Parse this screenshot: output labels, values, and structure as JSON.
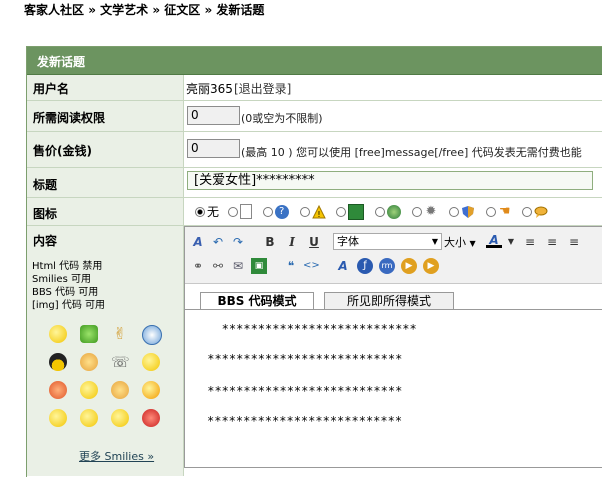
{
  "breadcrumb": {
    "items": [
      "客家人社区",
      "文学艺术",
      "征文区",
      "发新话题"
    ],
    "sep": " » "
  },
  "panel": {
    "title": "发新话题"
  },
  "form": {
    "username": {
      "label": "用户名",
      "value": "亮丽365",
      "logout": "[退出登录]"
    },
    "read_perm": {
      "label": "所需阅读权限",
      "value": "0",
      "hint": "(0或空为不限制)"
    },
    "price": {
      "label": "售价(金钱)",
      "value": "0",
      "hint": "(最高 10 ) 您可以使用 [free]message[/free] 代码发表无需付费也能"
    },
    "title": {
      "label": "标题",
      "value": "[关爱女性]*********"
    },
    "icon": {
      "label": "图标",
      "none_label": "无"
    },
    "content": {
      "label": "内容",
      "html_code": "Html 代码 禁用",
      "smilies": "Smilies 可用",
      "bbs_code": "BBS 代码 可用",
      "img_code": "[img] 代码 可用",
      "more_smilies": "更多 Smilies »"
    }
  },
  "editor": {
    "font_select": "字体",
    "size_select": "大小",
    "tabs": [
      "BBS 代码模式",
      "所见即所得模式"
    ],
    "lines": [
      "   ***************************",
      " ***************************",
      " ***************************",
      "***************************"
    ]
  },
  "colors": {
    "header_bg": "#6c9460",
    "label_bg": "#eaf0e6",
    "border": "#c7d6c0"
  }
}
